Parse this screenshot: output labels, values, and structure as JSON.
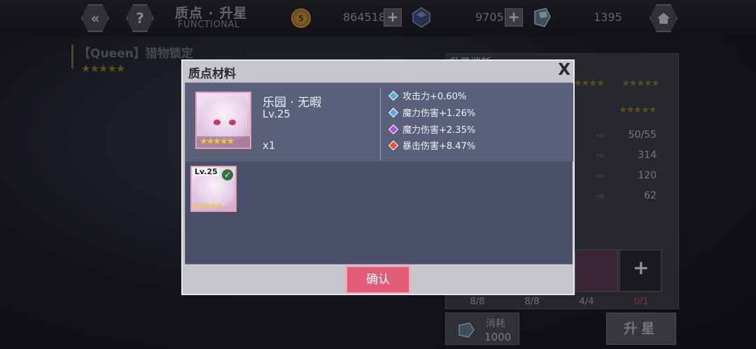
{
  "header": {
    "title_cn": "质点 · 升星",
    "title_en": "FUNCTIONAL",
    "back_icon": "chevron-left-icon",
    "help_icon": "question-icon",
    "home_icon": "home-icon"
  },
  "resources": {
    "coin_label": "5",
    "gold": "864518",
    "crystal": "9705",
    "ice_crystal": "1395"
  },
  "background": {
    "unit_title": "【Queen】猎物锁定",
    "panel_header": "升星消耗",
    "stat_rows": [
      {
        "value": "50/55"
      },
      {
        "value": "314"
      },
      {
        "value": "120"
      },
      {
        "value": "62"
      }
    ],
    "material_counts": [
      "8/8",
      "8/8",
      "4/4",
      "0/1"
    ],
    "cost_label": "消耗",
    "cost_value": "1000",
    "star_up_label": "升星"
  },
  "modal": {
    "title": "质点材料",
    "close_label": "X",
    "character": {
      "name": "乐园 · 无暇",
      "level": "Lv.25",
      "quantity": "x1",
      "stars": "★★★★★"
    },
    "stats": [
      {
        "text": "攻击力+0.60%",
        "color": "#5aa8e8"
      },
      {
        "text": "魔力伤害+1.26%",
        "color": "#5aa8e8"
      },
      {
        "text": "魔力伤害+2.35%",
        "color": "#a657d8"
      },
      {
        "text": "暴击伤害+8.47%",
        "color": "#e2553a"
      }
    ],
    "selected_item": {
      "level": "Lv.25",
      "stars": "★★★★★",
      "checked": true
    },
    "confirm_label": "确认"
  }
}
